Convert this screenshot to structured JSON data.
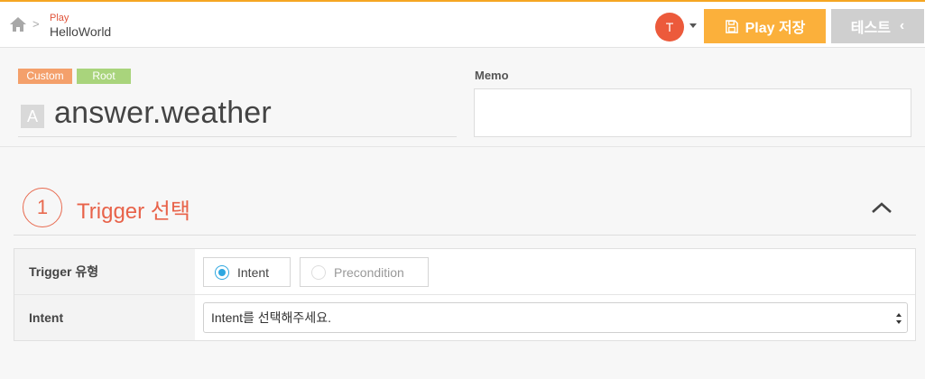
{
  "header": {
    "breadcrumb_parent": "Play",
    "breadcrumb_current": "HelloWorld",
    "breadcrumb_separator": ">",
    "avatar_initial": "T",
    "save_button_label": "Play 저장",
    "test_button_label": "테스트",
    "test_button_chevron": "‹",
    "accent_color": "#fbb03b",
    "avatar_color": "#ec5a3b"
  },
  "entity": {
    "tags": [
      "Custom",
      "Root"
    ],
    "type_letter": "A",
    "name": "answer.weather"
  },
  "memo": {
    "label": "Memo",
    "value": ""
  },
  "section": {
    "step_number": "1",
    "title": "Trigger 선택",
    "title_color": "#e8634a"
  },
  "form": {
    "trigger_type_label": "Trigger 유형",
    "trigger_options": [
      {
        "label": "Intent",
        "selected": true
      },
      {
        "label": "Precondition",
        "selected": false
      }
    ],
    "intent_label": "Intent",
    "intent_select_value": "Intent를 선택해주세요."
  },
  "icons": [
    "home-icon",
    "chevron-right-icon",
    "caret-down-icon",
    "save-icon",
    "chevron-left-icon",
    "chevron-up-icon",
    "select-arrows-icon"
  ]
}
